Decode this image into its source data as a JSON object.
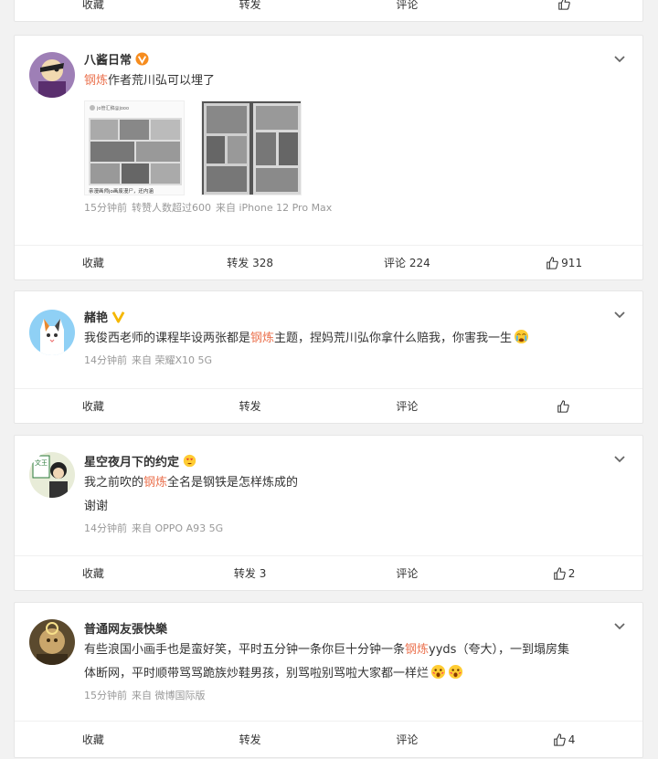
{
  "top_partial": {
    "actions": [
      "收藏",
      "转发",
      "评论",
      ""
    ]
  },
  "posts": [
    {
      "username": "八酱日常",
      "badge": "orange-v",
      "text_highlight": "钢炼",
      "text_rest": "作者荒川弘可以埋了",
      "image1_caption": "亲漫画师jo画废漫尸，还内涵",
      "image1_user": "jo管汇稿@jooo",
      "meta": [
        "15分钟前",
        "转赞人数超过600",
        "来自 iPhone 12 Pro Max"
      ],
      "actions": {
        "fav": "收藏",
        "repost": "转发 328",
        "comment": "评论 224",
        "like": "911"
      }
    },
    {
      "username": "赭艳",
      "badge": "yellow-v",
      "text_before": "我俊西老师的课程毕设两张都是",
      "text_highlight": "钢炼",
      "text_after": "主题，捏妈荒川弘你拿什么赔我，你害我一生",
      "meta": [
        "14分钟前",
        "来自 荣耀X10 5G"
      ],
      "actions": {
        "fav": "收藏",
        "repost": "转发",
        "comment": "评论",
        "like": ""
      }
    },
    {
      "username": "星空夜月下的约定",
      "badge": "heart-eyes-emoji",
      "text_before": "我之前吹的",
      "text_highlight": "钢炼",
      "text_after": "全名是钢铁是怎样炼成的",
      "text_line2": "谢谢",
      "meta": [
        "14分钟前",
        "来自 OPPO A93 5G"
      ],
      "actions": {
        "fav": "收藏",
        "repost": "转发 3",
        "comment": "评论",
        "like": "2"
      }
    },
    {
      "username": "普通网友張快樂",
      "text_before": "有些浪国小画手也是蛮好笑，平时五分钟一条你巨十分钟一条",
      "text_highlight": "钢炼",
      "text_after": "yyds（夸大），一到塌房集",
      "text_line2": "体断网，平时顺带骂骂跪族炒鞋男孩，别骂啦别骂啦大家都一样烂",
      "meta": [
        "15分钟前",
        "来自 微博国际版"
      ],
      "actions": {
        "fav": "收藏",
        "repost": "转发",
        "comment": "评论",
        "like": "4"
      }
    }
  ],
  "colors": {
    "highlight": "#eb7350",
    "meta": "#999999",
    "bg": "#f2f2f2"
  }
}
